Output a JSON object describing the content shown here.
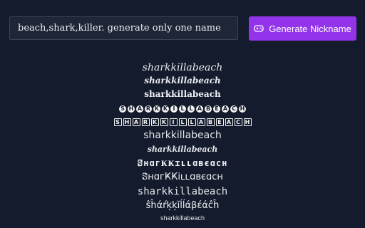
{
  "prompt_input": {
    "value": "beach,shark,killer. generate only one name"
  },
  "generate_button": {
    "label": "Generate Nickname",
    "icon": "gamepad-icon",
    "color": "#9333ea"
  },
  "nicknames": [
    "sharkkillabeach",
    "sharkkillabeach",
    "sharkkillabeach",
    "SHARKKILLABEACH",
    "SHARKKILLABEACH",
    "sharkkillabeach",
    "sharkkillabeach",
    "ꗟнɑгҜҜɪʟʟɑвєɑcн",
    "ꗟнɑгҜҜiʟʟɑʙєɑcн",
    "sharkkillabeach",
    "ŝĥάŕķķĭĺĺάβέάĉĥ",
    "sharkkillabeach"
  ],
  "colors": {
    "background": "#141b2d",
    "input_background": "#1f2737",
    "text": "#e5e7eb"
  }
}
